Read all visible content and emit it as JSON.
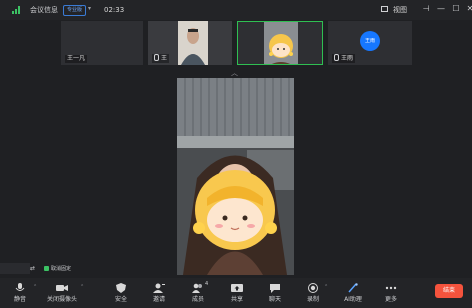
{
  "top_bar": {
    "meeting_info": "会议信息",
    "badge": "专业版",
    "timer": "02:33",
    "view_label": "视图"
  },
  "participants": [
    {
      "name": "王一凡"
    },
    {
      "name": "王",
      "mic": true
    },
    {
      "name": "",
      "active": true
    },
    {
      "name": "王雨",
      "mic": true,
      "avatar": "王雨"
    }
  ],
  "caption_toggle": "取消固定",
  "toolbar": {
    "mute": "静音",
    "camera": "关闭摄像头",
    "security": "安全",
    "invite": "邀请",
    "members": "成员",
    "members_count": "4",
    "share": "共享",
    "chat": "聊天",
    "record": "录制",
    "ai_assistant": "AI助理",
    "more": "更多",
    "end": "结束"
  },
  "colors": {
    "accent_green": "#2fbf52",
    "end_red": "#f5533d",
    "avatar_blue": "#1677ff"
  },
  "icons": [
    "signal-icon",
    "chevron-icon",
    "view-grid-icon",
    "pin-icon",
    "minimize-icon",
    "maximize-icon",
    "close-icon",
    "collapse-up-icon",
    "mic-icon",
    "camera-icon",
    "shield-icon",
    "invite-icon",
    "members-icon",
    "share-icon",
    "chat-icon",
    "record-icon",
    "ai-icon",
    "more-icon"
  ]
}
